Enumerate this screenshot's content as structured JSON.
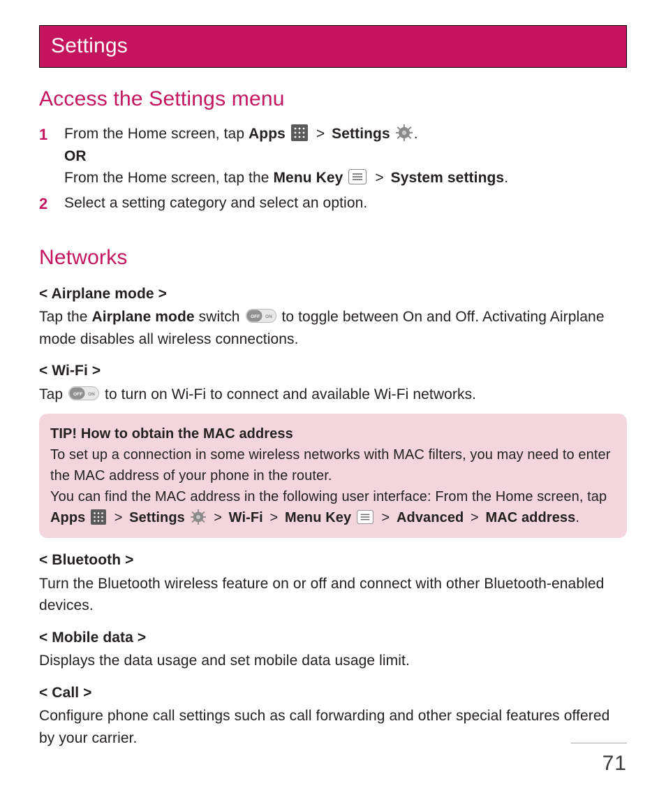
{
  "chapter_title": "Settings",
  "page_number": "71",
  "section_access": {
    "heading": "Access the Settings menu",
    "step1_num": "1",
    "step1_pre": "From the Home screen, tap ",
    "step1_apps": "Apps",
    "step1_sep1": " > ",
    "step1_settings": "Settings",
    "step1_dot": ".",
    "step1_or": "OR",
    "step1_line2_pre": "From the Home screen, tap the ",
    "step1_menukey": "Menu Key",
    "step1_sep2": " > ",
    "step1_system": "System settings",
    "step1_dot2": ".",
    "step2_num": "2",
    "step2_text": "Select a setting category and select an option."
  },
  "section_networks": {
    "heading": "Networks",
    "airplane_head": "< Airplane mode >",
    "airplane_pre": "Tap the ",
    "airplane_bold": "Airplane mode",
    "airplane_mid": " switch ",
    "airplane_post": " to toggle between On and Off. Activating Airplane mode disables all wireless connections.",
    "wifi_head": "< Wi-Fi >",
    "wifi_pre": "Tap ",
    "wifi_post": " to turn on Wi-Fi to connect and available Wi-Fi networks.",
    "tip_title": "TIP! How to obtain the MAC address",
    "tip_p1": "To set up a connection in some wireless networks with MAC filters, you may need to enter the MAC address of your phone in the router.",
    "tip_p2_pre": "You can find the MAC address in the following user interface: From the Home screen, tap ",
    "tip_apps": "Apps",
    "tip_sep1": " > ",
    "tip_settings": "Settings",
    "tip_sep2": " > ",
    "tip_wifi": "Wi-Fi",
    "tip_sep3": " > ",
    "tip_menukey": "Menu Key",
    "tip_sep4": " > ",
    "tip_advanced": "Advanced",
    "tip_sep5": " > ",
    "tip_mac": "MAC address",
    "tip_dot": ".",
    "bt_head": "< Bluetooth >",
    "bt_text": "Turn the Bluetooth wireless feature on or off and connect with other Bluetooth-enabled devices.",
    "md_head": "< Mobile data >",
    "md_text": "Displays the data usage and set mobile data usage limit.",
    "call_head": "< Call >",
    "call_text": "Configure phone call settings such as call forwarding and other special features offered by your carrier."
  }
}
